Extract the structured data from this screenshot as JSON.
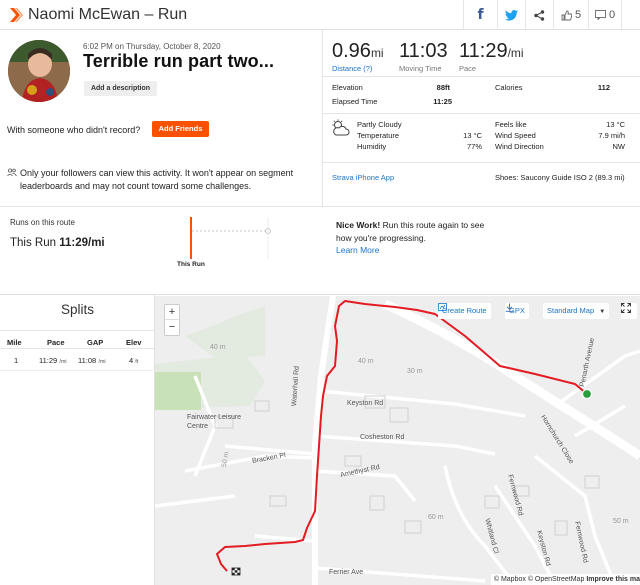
{
  "header": {
    "title": "Naomi McEwan – Run",
    "kudos_count": "5",
    "comments_count": "0"
  },
  "activity": {
    "datetime": "6:02 PM on Thursday, October 8, 2020",
    "title": "Terrible run part two...",
    "add_description": "Add a description",
    "with_someone": "With someone who didn't record?",
    "add_friends": "Add Friends",
    "privacy_note": "Only your followers can view this activity. It won't appear on segment leaderboards and may not count toward some challenges."
  },
  "stats": {
    "distance": {
      "value": "0.96",
      "unit": "mi",
      "label": "Distance (?)"
    },
    "moving_time": {
      "value": "11:03",
      "label": "Moving Time"
    },
    "pace": {
      "value": "11:29",
      "unit": "/mi",
      "label": "Pace"
    },
    "elevation": {
      "label": "Elevation",
      "value": "88ft"
    },
    "calories": {
      "label": "Calories",
      "value": "112"
    },
    "elapsed": {
      "label": "Elapsed Time",
      "value": "11:25"
    },
    "weather": {
      "condition": "Partly Cloudy",
      "temperature_label": "Temperature",
      "temperature": "13 °C",
      "humidity_label": "Humidity",
      "humidity": "77%",
      "feels_like_label": "Feels like",
      "feels_like": "13 °C",
      "wind_speed_label": "Wind Speed",
      "wind_speed": "7.9 mi/h",
      "wind_dir_label": "Wind Direction",
      "wind_dir": "NW"
    },
    "device": "Strava iPhone App",
    "shoes": "Shoes: Saucony Guide ISO 2 (89.3 mi)"
  },
  "route": {
    "label": "Runs on this route",
    "this_run_prefix": "This Run",
    "this_run_pace": "11:29/mi",
    "chart_label": "This Run",
    "nice_bold": "Nice Work!",
    "nice_text": "Run this route again to see how you're progressing.",
    "learn_more": "Learn More"
  },
  "splits": {
    "title": "Splits",
    "headers": [
      "Mile",
      "Pace",
      "GAP",
      "Elev"
    ],
    "rows": [
      {
        "mile": "1",
        "pace": "11:29",
        "pace_unit": "/mi",
        "gap": "11:08",
        "gap_unit": "/mi",
        "elev": "4",
        "elev_unit": "ft"
      }
    ]
  },
  "map": {
    "zoom_in": "+",
    "zoom_out": "−",
    "create_route": "Create Route",
    "gpx": "GPX",
    "map_style": "Standard Map",
    "roads": {
      "keyston": "Keyston Rd",
      "cosheston": "Cosheston Rd",
      "amethyst": "Amethyst Rd",
      "bracken": "Bracken Pl",
      "waterhall": "Waterhall Rd",
      "fairwater": "Fairwater Leisure Centre",
      "hornchurch": "Hornchurch Close",
      "fernwood": "Fernwood Rd",
      "whitland": "Whitland Cl",
      "keyston2": "Keyston Rd",
      "fernwood2": "Fernwood Rd",
      "penarth": "Penarth Avenue",
      "ferrier": "Ferrier Ave"
    },
    "contour_labels": [
      "40 m",
      "40 m",
      "30 m",
      "50 m",
      "60 m",
      "50 m"
    ],
    "attribution_mapbox": "© Mapbox",
    "attribution_osm": "© OpenStreetMap",
    "attribution_improve": "Improve this ma"
  },
  "colors": {
    "accent": "#fc5200",
    "route": "#e31b23",
    "link": "#1a73c9"
  }
}
